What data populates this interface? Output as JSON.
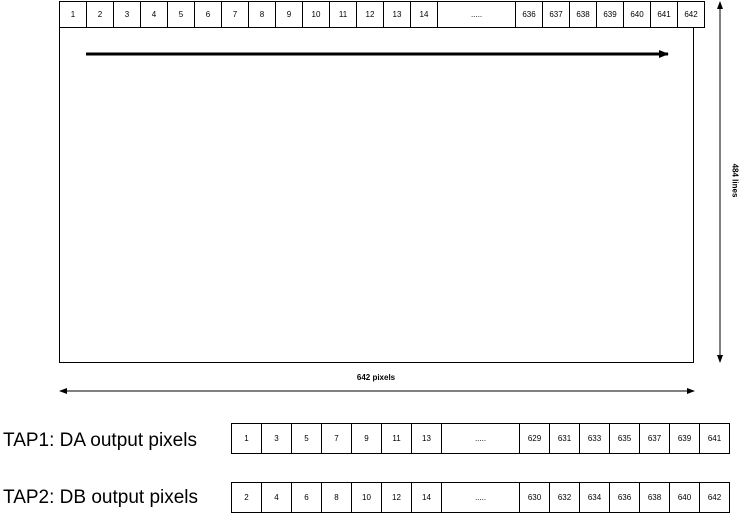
{
  "frame": {
    "pixel_header": [
      "1",
      "2",
      "3",
      "4",
      "5",
      "6",
      "7",
      "8",
      "9",
      "10",
      "11",
      "12",
      "13",
      "14",
      ".....",
      "636",
      "637",
      "638",
      "639",
      "640",
      "641",
      "642"
    ]
  },
  "dimensions": {
    "width_label": "642 pixels",
    "height_label": "484 lines"
  },
  "taps": [
    {
      "label": "TAP1: DA output pixels",
      "cells": [
        "1",
        "3",
        "5",
        "7",
        "9",
        "11",
        "13",
        ".....",
        "629",
        "631",
        "633",
        "635",
        "637",
        "639",
        "641"
      ]
    },
    {
      "label": "TAP2: DB output pixels",
      "cells": [
        "2",
        "4",
        "6",
        "8",
        "10",
        "12",
        "14",
        ".....",
        "630",
        "632",
        "634",
        "636",
        "638",
        "640",
        "642"
      ]
    }
  ],
  "colors": {
    "line": "#000000",
    "background": "#ffffff"
  }
}
